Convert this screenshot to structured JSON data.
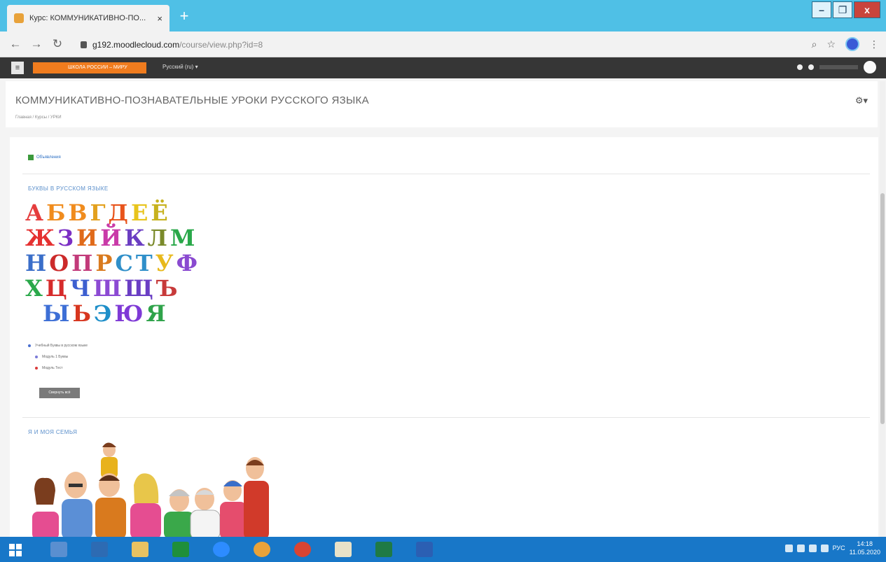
{
  "browser": {
    "tab_title": "Курс: КОММУНИКАТИВНО-ПО...",
    "tab_close": "×",
    "new_tab": "+",
    "url_domain": "g192.moodlecloud.com",
    "url_path": "/course/view.php?id=8",
    "window_buttons": [
      "–",
      "❐",
      "x"
    ]
  },
  "navbar": {
    "menu_glyph": "≡",
    "site_name": "ШКОЛА РОССИИ – МИРУ",
    "language": "Русский (ru) ▾"
  },
  "header": {
    "course_title": "КОММУНИКАТИВНО-ПОЗНАВАТЕЛЬНЫЕ УРОКИ РУССКОГО ЯЗЫКА",
    "breadcrumb": "Главная / Курсы / УРКИ",
    "gear": "⚙▾"
  },
  "main": {
    "announcements": "Объявления",
    "section1_title": "БУКВЫ В РУССКОМ ЯЗЫКЕ",
    "section2_title": "Я И МОЯ СЕМЬЯ",
    "modules": [
      {
        "label": "Учебный Буквы в русском языке",
        "color": "#4a6fcf"
      },
      {
        "label": "Модуль 1 Буквы",
        "color": "#7a7ad8"
      },
      {
        "label": "Модуль Тест",
        "color": "#d93b3b"
      }
    ],
    "expand_button": "Свернуть всё"
  },
  "alphabet": {
    "rows": [
      [
        {
          "ch": "А",
          "c": "#e53d3d"
        },
        {
          "ch": "Б",
          "c": "#f08c1e"
        },
        {
          "ch": "В",
          "c": "#f08c1e"
        },
        {
          "ch": "Г",
          "c": "#e3a11f"
        },
        {
          "ch": "Д",
          "c": "#e8541c"
        },
        {
          "ch": "Е",
          "c": "#e8c41c"
        },
        {
          "ch": "Ё",
          "c": "#c7b21e"
        }
      ],
      [
        {
          "ch": "Ж",
          "c": "#e53131"
        },
        {
          "ch": "З",
          "c": "#7b2fc4"
        },
        {
          "ch": "И",
          "c": "#e06a1a"
        },
        {
          "ch": "Й",
          "c": "#c93aa8"
        },
        {
          "ch": "К",
          "c": "#6b3ec2"
        },
        {
          "ch": "Л",
          "c": "#7a8a2a"
        },
        {
          "ch": "М",
          "c": "#2aa84a"
        }
      ],
      [
        {
          "ch": "Н",
          "c": "#3a6ec9"
        },
        {
          "ch": "О",
          "c": "#cc2a2a"
        },
        {
          "ch": "П",
          "c": "#c23a7a"
        },
        {
          "ch": "Р",
          "c": "#d97a1e"
        },
        {
          "ch": "С",
          "c": "#2f8fc9"
        },
        {
          "ch": "Т",
          "c": "#2f8fc9"
        },
        {
          "ch": "У",
          "c": "#e8b91c"
        },
        {
          "ch": "Ф",
          "c": "#8a4ad0"
        }
      ],
      [
        {
          "ch": "Х",
          "c": "#2aa84a"
        },
        {
          "ch": "Ц",
          "c": "#d62b2b"
        },
        {
          "ch": "Ч",
          "c": "#3d5fd0"
        },
        {
          "ch": "Ш",
          "c": "#8c4ad3"
        },
        {
          "ch": "Щ",
          "c": "#6a3ec4"
        },
        {
          "ch": "Ъ",
          "c": "#c73a3a"
        }
      ],
      [
        {
          "ch": "Ы",
          "c": "#3d6fd6"
        },
        {
          "ch": "Ь",
          "c": "#d7361f"
        },
        {
          "ch": "Э",
          "c": "#1f8fc9"
        },
        {
          "ch": "Ю",
          "c": "#7f3ad6"
        },
        {
          "ch": "Я",
          "c": "#2fa34a"
        }
      ]
    ]
  },
  "taskbar": {
    "language": "РУС",
    "time": "14:18",
    "date": "11.05.2020"
  }
}
